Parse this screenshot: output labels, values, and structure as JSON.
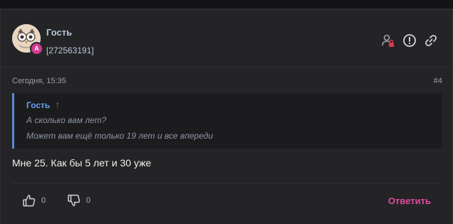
{
  "post": {
    "author": "Гость",
    "author_id": "[272563191]",
    "avatar_badge": "A",
    "date": "Сегодня, 15:35",
    "number": "#4",
    "message": "Мне 25. Как бы 5 лет и 30 уже"
  },
  "quote": {
    "author": "Гость",
    "arrow": "↑",
    "lines": [
      "А сколько вам лет?",
      "Может вам ещё только 19 лет и все впереди"
    ]
  },
  "footer": {
    "likes": "0",
    "dislikes": "0",
    "reply_label": "Ответить"
  },
  "icons": {
    "header": [
      "user-lock-icon",
      "report-icon",
      "link-icon"
    ],
    "footer": [
      "thumbs-up-icon",
      "thumbs-down-icon"
    ]
  },
  "colors": {
    "accent_pink": "#e04aa0",
    "quote_blue": "#5b8ad6",
    "background": "#242426",
    "lock_red": "#e0364f"
  }
}
